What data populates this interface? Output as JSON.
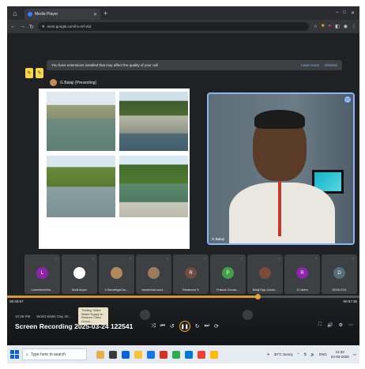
{
  "browser": {
    "tab_title": "Media Player",
    "url": "meet.google.com/hv-nrf-vkd",
    "window_controls": [
      "–",
      "□",
      "✕"
    ]
  },
  "meet": {
    "warning_text": "You have extensions installed that may affect the quality of your call",
    "warning_learn_more": "Learn more",
    "warning_dismiss": "Dismiss",
    "presenter_label": "G Balaji (Presenting)",
    "camera_name": "G Balaji",
    "participants": [
      {
        "name": "Lokeshchechha…",
        "initial": "L",
        "color": "#8e24aa"
      },
      {
        "name": "Muhil Anyen",
        "initial": "",
        "color": "#ffffff"
      },
      {
        "name": "A RamalingaCha…",
        "initial": "",
        "color": "#b08a5a"
      },
      {
        "name": "narasimhan sund…",
        "initial": "",
        "color": "#9c7b5b"
      },
      {
        "name": "Ramkumar G",
        "initial": "R",
        "color": "#6d4c41"
      },
      {
        "name": "Prakash Gurusa…",
        "initial": "P",
        "color": "#43a047"
      },
      {
        "name": "Balaji Raju Gosha…",
        "initial": "",
        "color": "#7a4a3a"
      },
      {
        "name": "10 others",
        "initial": "R",
        "color": "#8e24aa"
      },
      {
        "name": "DEAN ECA",
        "initial": "D",
        "color": "#546e7a"
      }
    ]
  },
  "player": {
    "time_elapsed": "00:40:57",
    "time_total": "00:57:35",
    "progress_fraction": 0.71,
    "meta_time": "10:36 PM",
    "meta_event": "World Water Day 20…",
    "popup_text": "Trading: Water Water Supply to Reserve Cities Group…",
    "recording_title": "Screen Recording 2025-03-24 122541"
  },
  "taskbar": {
    "search_placeholder": "Type here to search",
    "weather": "30°C Sunny",
    "lang": "ENG",
    "time": "14:32",
    "date": "24-03-2025"
  }
}
